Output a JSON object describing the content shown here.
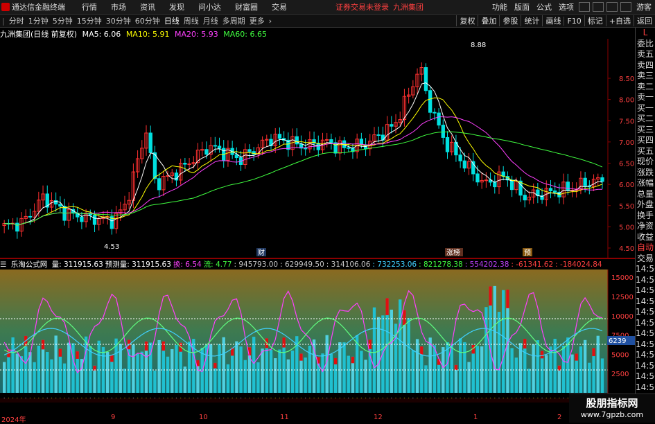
{
  "topbar": {
    "app_title": "通达信金融终端",
    "menus": [
      "行情",
      "市场",
      "资讯",
      "发现",
      "问小达",
      "财富圈",
      "交易"
    ],
    "notice": "证券交易未登录",
    "stock": "九洲集团",
    "right_menus": [
      "功能",
      "版面",
      "公式",
      "选项"
    ],
    "guest": "游客"
  },
  "toolbar": {
    "periods": [
      "分时",
      "1分钟",
      "5分钟",
      "15分钟",
      "30分钟",
      "60分钟",
      "日线",
      "周线",
      "月线",
      "多周期",
      "更多"
    ],
    "active_period": "日线",
    "right_tools": [
      "复权",
      "叠加",
      "参股",
      "统计",
      "画线",
      "F10",
      "标记",
      "+自选",
      "返回"
    ]
  },
  "quote": {
    "title": "九洲集团(日线 前复权)",
    "ma5": "MA5: 6.06",
    "ma10": "MA10: 5.91",
    "ma20": "MA20: 5.93",
    "ma60": "MA60: 6.65",
    "high_label": "8.88",
    "low_label": "4.53",
    "markers": [
      "财",
      "涨榜",
      "预"
    ],
    "price_ticks": [
      "8.50",
      "8.00",
      "7.50",
      "7.00",
      "6.50",
      "6.00",
      "5.50",
      "5.00",
      "4.50"
    ],
    "price_tick_values": [
      8.5,
      8.0,
      7.5,
      7.0,
      6.5,
      6.0,
      5.5,
      5.0,
      4.5
    ]
  },
  "indicator": {
    "name": "乐淘公式网",
    "values": [
      "量: 311915.63",
      "预测量: 311915.63",
      "换: 6.54",
      "流: 4.77",
      ": 945793.00",
      ": 629949.50",
      ": 314106.06",
      ": 732253.06",
      ": 821278.38",
      ": 554202.38",
      ": -61341.62",
      ": -184024.84"
    ],
    "value_colors": [
      "#ffffff",
      "#ffffff",
      "#ff40ff",
      "#40ff40",
      "#c8c8c8",
      "#c8c8c8",
      "#c8c8c8",
      "#40d0ff",
      "#40ff40",
      "#c040ff",
      "#ff4040",
      "#ff4040"
    ],
    "axis_ticks": [
      "15000",
      "12500",
      "10000",
      "7500",
      "5000",
      "2500"
    ],
    "axis_tick_values": [
      15000,
      12500,
      10000,
      7500,
      5000,
      2500
    ],
    "current_value": "6239"
  },
  "sidepanel": {
    "items": [
      "L",
      "委比",
      "卖五",
      "卖四",
      "卖三",
      "卖二",
      "卖一",
      "买一",
      "买二",
      "买三",
      "买四",
      "买五",
      "现价",
      "涨跌",
      "涨幅",
      "总量",
      "外盘",
      "换手",
      "净资",
      "收益",
      "自动",
      "交易"
    ],
    "times": [
      "14:56",
      "14:56",
      "14:56",
      "14:56",
      "14:56",
      "14:56",
      "14:56",
      "14:56",
      "14:56",
      "14:56",
      "14:56",
      "14:56"
    ]
  },
  "dates": [
    "2024年",
    "9",
    "10",
    "11",
    "12",
    "1",
    "2"
  ],
  "watermark": {
    "line1": "股朋指标网",
    "line2": "www.7gpzb.com"
  },
  "colors": {
    "up": "#ff3030",
    "down": "#00e0e0",
    "ma5": "#ffffff",
    "ma10": "#ffff00",
    "ma20": "#ff40ff",
    "ma60": "#40ff40"
  }
}
